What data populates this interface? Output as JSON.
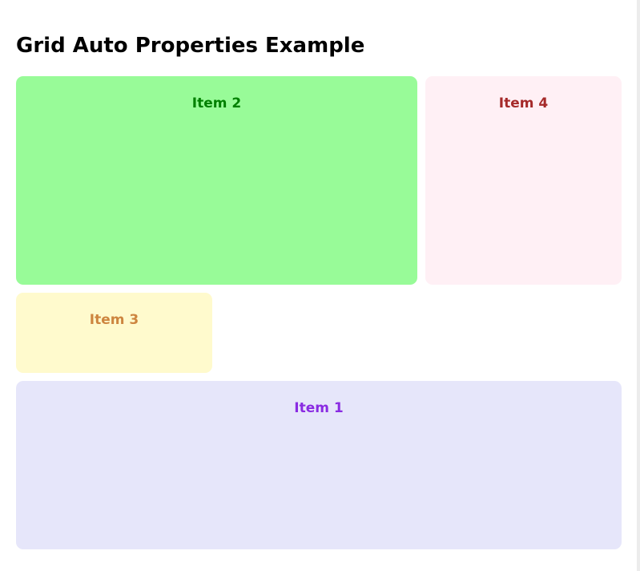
{
  "page": {
    "title": "Grid Auto Properties Example"
  },
  "items": [
    {
      "id": "item-2",
      "label": "Item 2",
      "background": "#98fb98",
      "text_color": "#008000"
    },
    {
      "id": "item-4",
      "label": "Item 4",
      "background": "#fff0f5",
      "text_color": "#a52a2a"
    },
    {
      "id": "item-3",
      "label": "Item 3",
      "background": "#fffacd",
      "text_color": "#cd853f"
    },
    {
      "id": "item-1",
      "label": "Item 1",
      "background": "#e6e6fa",
      "text_color": "#8a2be2"
    }
  ]
}
